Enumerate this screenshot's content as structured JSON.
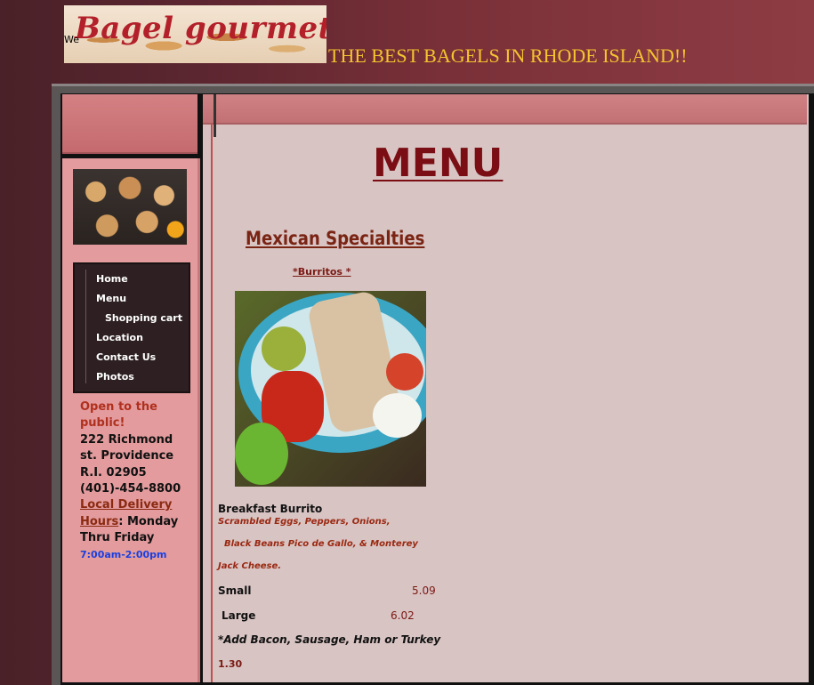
{
  "header": {
    "logo_text": "Bagel gourmet cafe",
    "logo_overlay": "We",
    "tagline": "THE BEST BAGELS IN RHODE ISLAND!!"
  },
  "nav": {
    "items": [
      {
        "label": "Home"
      },
      {
        "label": "Menu"
      },
      {
        "label": "Shopping cart"
      },
      {
        "label": "Location"
      },
      {
        "label": "Contact Us"
      },
      {
        "label": "Photos"
      }
    ]
  },
  "sidebar": {
    "open_line1": "Open to the",
    "open_line2": "public!",
    "address1": "222 Richmond",
    "address2": "st. Providence",
    "address3": "R.I. 02905",
    "phone": "(401)-454-8800",
    "delivery_link1": "Local Delivery",
    "delivery_link2": "Hours",
    "days1": ": Monday",
    "days2": "Thru Friday",
    "hours": "7:00am-2:00pm"
  },
  "main": {
    "title": "MENU",
    "section": "Mexican Specialties",
    "subsection": "*Burritos * ",
    "item": {
      "name": "Breakfast Burrito",
      "desc1": "Scrambled Eggs, Peppers, Onions,",
      "desc2": "Black Beans   Pico de Gallo,  &  Monterey",
      "desc3": "Jack Cheese.",
      "small_label": "Small",
      "small_price": "5.09",
      "large_label": "Large",
      "large_price": "6.02",
      "addon": "*Add Bacon, Sausage, Ham or Turkey",
      "addon_price": "1.30"
    }
  }
}
